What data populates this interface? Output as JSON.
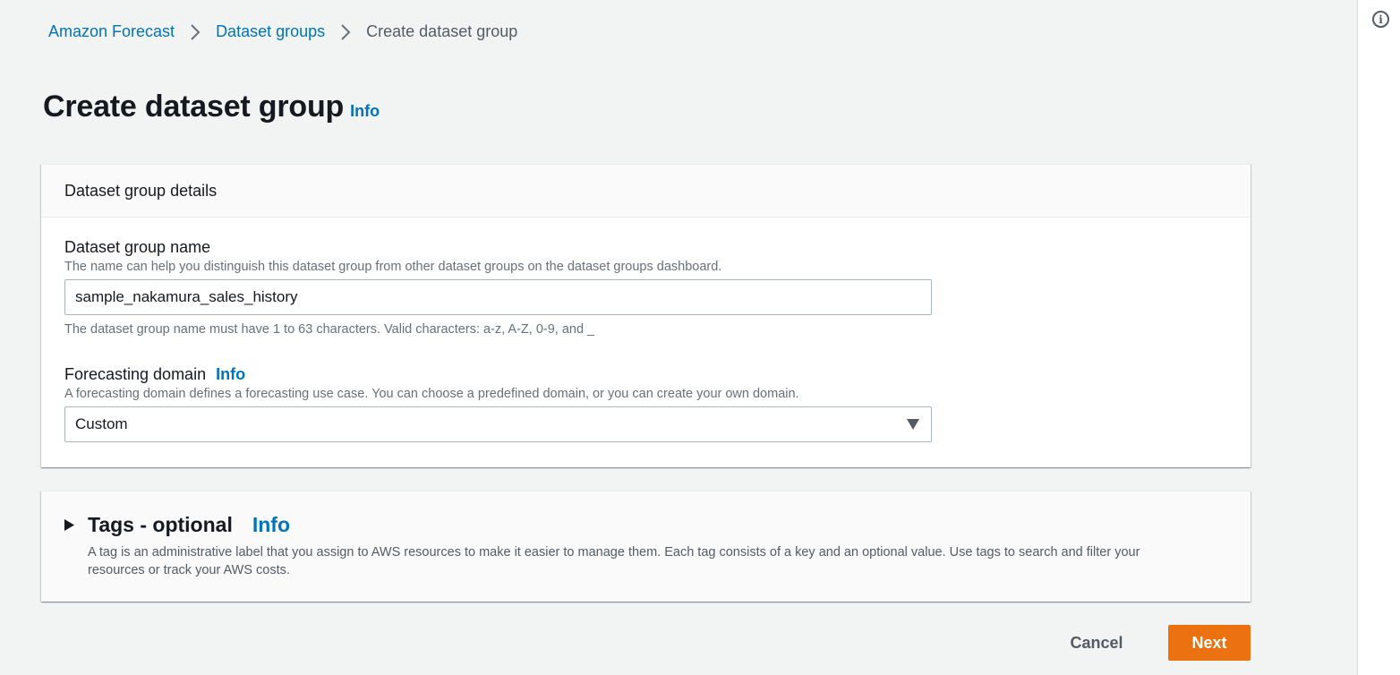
{
  "breadcrumb": {
    "items": [
      "Amazon Forecast",
      "Dataset groups"
    ],
    "current": "Create dataset group"
  },
  "header": {
    "title": "Create dataset group",
    "info": "Info"
  },
  "details": {
    "heading": "Dataset group details",
    "name_field": {
      "label": "Dataset group name",
      "description": "The name can help you distinguish this dataset group from other dataset groups on the dataset groups dashboard.",
      "value": "sample_nakamura_sales_history",
      "constraint": "The dataset group name must have 1 to 63 characters. Valid characters: a-z, A-Z, 0-9, and _"
    },
    "domain_field": {
      "label": "Forecasting domain",
      "info": "Info",
      "description": "A forecasting domain defines a forecasting use case. You can choose a predefined domain, or you can create your own domain.",
      "selected": "Custom"
    }
  },
  "tags": {
    "title": "Tags - optional",
    "info": "Info",
    "description": "A tag is an administrative label that you assign to AWS resources to make it easier to manage them. Each tag consists of a key and an optional value. Use tags to search and filter your resources or track your AWS costs."
  },
  "actions": {
    "cancel": "Cancel",
    "next": "Next"
  },
  "icons": {
    "rail": "info-circle-icon",
    "breadcrumb_separator": "chevron-right-icon",
    "select": "caret-down-icon",
    "expand": "caret-right-icon"
  },
  "colors": {
    "link": "#0073bb",
    "primary_button": "#ec7211",
    "background": "#f2f3f3"
  }
}
